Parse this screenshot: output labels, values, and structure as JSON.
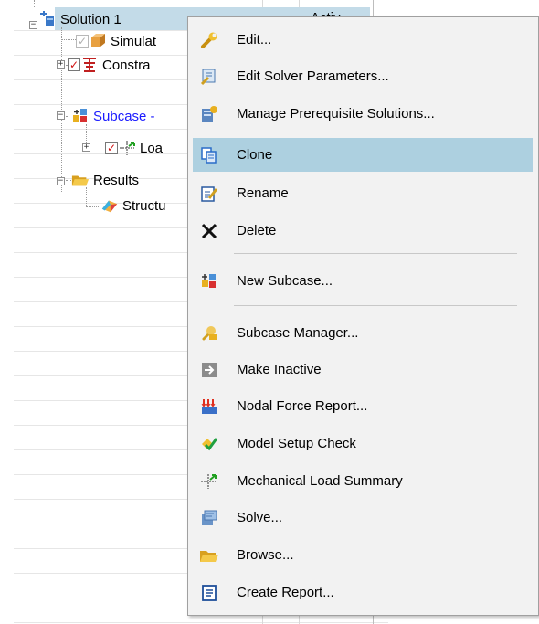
{
  "tree": {
    "items": [
      {
        "label": "Solution 1"
      },
      {
        "label": "Simulat"
      },
      {
        "label": "Constra"
      },
      {
        "label": "Subcase -"
      },
      {
        "label": "Loa"
      },
      {
        "label": "Results"
      },
      {
        "label": "Structu"
      }
    ],
    "column_header": "Activ"
  },
  "menu": {
    "items": [
      {
        "label": "Edit...",
        "icon": "wrench-icon"
      },
      {
        "label": "Edit Solver Parameters...",
        "icon": "solver-params-icon"
      },
      {
        "label": "Manage Prerequisite Solutions...",
        "icon": "prerequisite-icon"
      },
      {
        "label": "Clone",
        "icon": "clone-icon",
        "highlighted": true
      },
      {
        "label": "Rename",
        "icon": "rename-icon"
      },
      {
        "label": "Delete",
        "icon": "delete-icon"
      },
      {
        "label": "New Subcase...",
        "icon": "new-subcase-icon"
      },
      {
        "label": "Subcase Manager...",
        "icon": "subcase-manager-icon"
      },
      {
        "label": "Make Inactive",
        "icon": "make-inactive-icon"
      },
      {
        "label": "Nodal Force Report...",
        "icon": "nodal-force-icon"
      },
      {
        "label": "Model Setup Check",
        "icon": "model-check-icon"
      },
      {
        "label": "Mechanical Load Summary",
        "icon": "mechanical-load-icon"
      },
      {
        "label": "Solve...",
        "icon": "solve-icon"
      },
      {
        "label": "Browse...",
        "icon": "browse-folder-icon"
      },
      {
        "label": "Create Report...",
        "icon": "report-icon"
      }
    ]
  },
  "colors": {
    "menu_background": "#f2f2f2",
    "menu_highlight": "#add0e0",
    "tree_selection": "#c3dbe8",
    "subcase_text": "#1a1aff"
  }
}
